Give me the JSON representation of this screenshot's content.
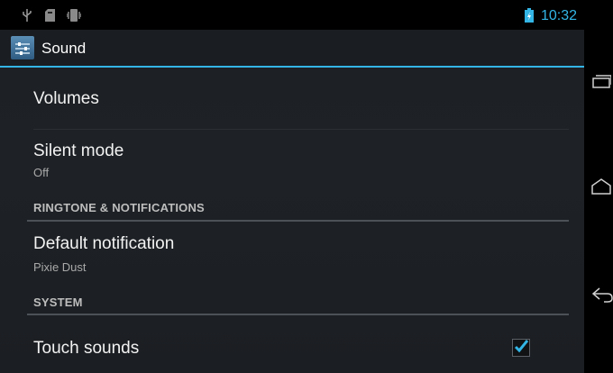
{
  "status_bar": {
    "time": "10:32",
    "icons": [
      "usb-icon",
      "sd-card-icon",
      "vibrate-icon",
      "battery-charging-icon"
    ]
  },
  "action_bar": {
    "title": "Sound",
    "icon": "sound-settings-app-icon"
  },
  "list": {
    "volumes": {
      "title": "Volumes"
    },
    "silent_mode": {
      "title": "Silent mode",
      "summary": "Off"
    },
    "section_ringtone": "RINGTONE & NOTIFICATIONS",
    "default_notification": {
      "title": "Default notification",
      "summary": "Pixie Dust"
    },
    "section_system": "SYSTEM",
    "touch_sounds": {
      "title": "Touch sounds",
      "checked": true
    }
  },
  "navigation": {
    "buttons": [
      "recent-apps-icon",
      "home-icon",
      "back-icon"
    ]
  },
  "colors": {
    "accent": "#33b5e5",
    "background": "#1e2226"
  }
}
